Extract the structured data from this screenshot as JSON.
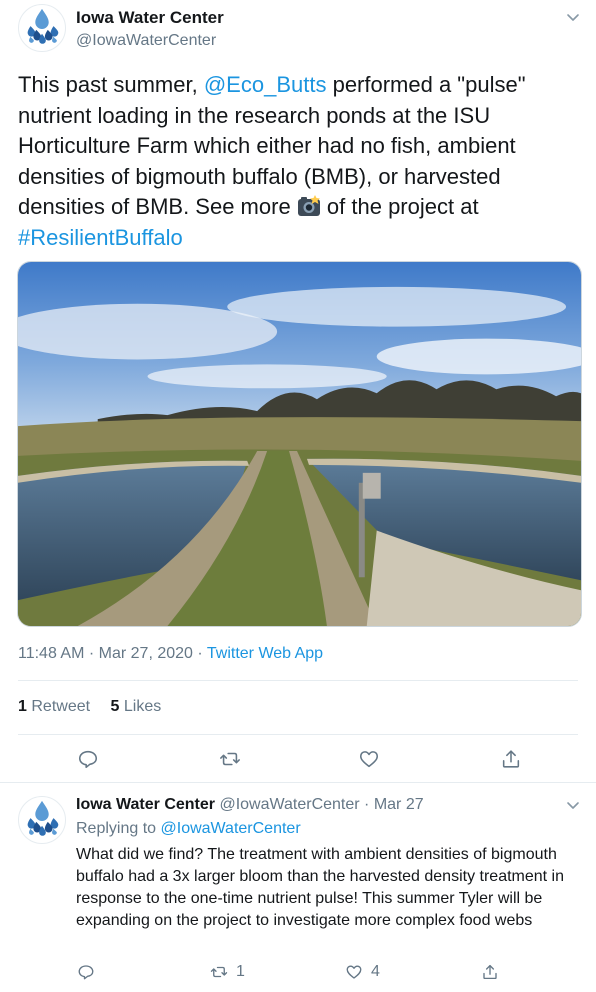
{
  "tweet": {
    "author_name": "Iowa Water Center",
    "author_handle": "@IowaWaterCenter",
    "text_1": "This past summer, ",
    "mention": "@Eco_Butts",
    "text_2": " performed a \"pulse\" nutrient loading in the research ponds at the ISU Horticulture Farm which either had no fish, ambient densities of bigmouth buffalo (BMB), or harvested densities of BMB. See more ",
    "emoji": "camera-with-flash",
    "text_3": " of the project at ",
    "hashtag": "#ResilientBuffalo",
    "time": "11:48 AM",
    "separator": "·",
    "date": "Mar 27, 2020",
    "app": "Twitter Web App",
    "retweets_count": "1",
    "retweets_label": "Retweet",
    "likes_count": "5",
    "likes_label": "Likes",
    "actions": [
      "reply-icon",
      "retweet-icon",
      "like-icon",
      "share-icon"
    ]
  },
  "reply": {
    "author_name": "Iowa Water Center",
    "author_handle": "@IowaWaterCenter",
    "separator": "·",
    "date": "Mar 27",
    "replying_label": "Replying to",
    "replying_to": "@IowaWaterCenter",
    "text": "What did we find? The treatment with ambient densities of bigmouth buffalo had a 3x larger bloom than the harvested density treatment in response to the one-time nutrient pulse! This summer Tyler will be expanding on the project to investigate more complex food webs",
    "retweets_count": "1",
    "likes_count": "4"
  },
  "colors": {
    "link": "#1b95e0",
    "secondary_text": "#657786",
    "primary_text": "#14171a",
    "logo_blue": "#2f6fb3"
  }
}
